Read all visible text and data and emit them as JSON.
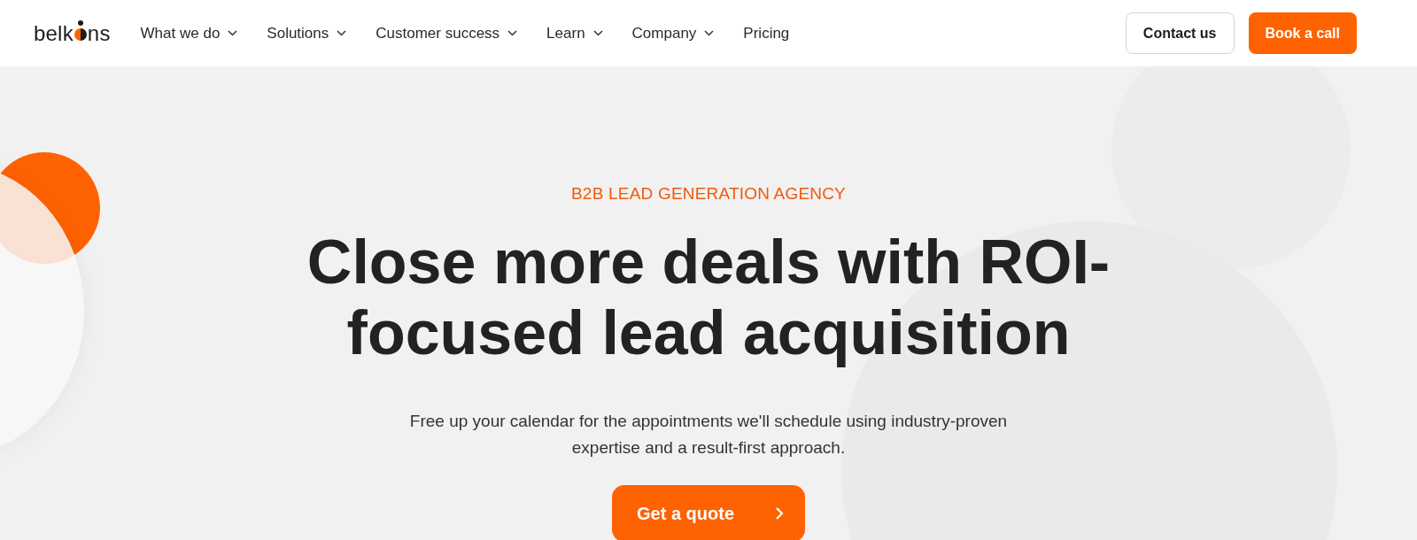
{
  "header": {
    "logo": {
      "before": "belk",
      "after": "ns"
    },
    "nav": [
      {
        "label": "What we do",
        "has_dropdown": true
      },
      {
        "label": "Solutions",
        "has_dropdown": true
      },
      {
        "label": "Customer success",
        "has_dropdown": true
      },
      {
        "label": "Learn",
        "has_dropdown": true
      },
      {
        "label": "Company",
        "has_dropdown": true
      },
      {
        "label": "Pricing",
        "has_dropdown": false
      }
    ],
    "buttons": [
      {
        "label": "Contact us",
        "kind": "outline"
      },
      {
        "label": "Book a call",
        "kind": "primary"
      }
    ]
  },
  "hero": {
    "eyebrow": "B2B LEAD GENERATION AGENCY",
    "title": "Close more deals with ROI-focused lead acquisition",
    "subtitle": "Free up your calendar for the appointments we'll schedule using industry-proven expertise and a result-first approach.",
    "cta": "Get a quote"
  }
}
